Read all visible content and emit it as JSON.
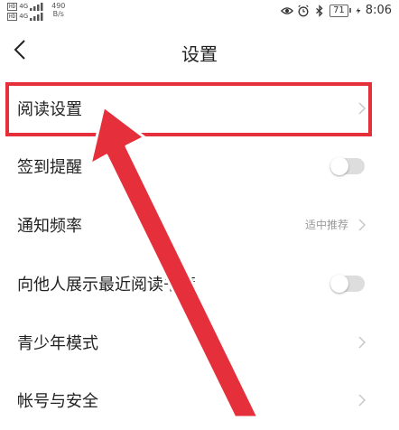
{
  "status_bar": {
    "sim1_label": "4G",
    "sim2_label": "4G",
    "net_speed_value": "490",
    "net_speed_unit": "B/s",
    "battery": "71",
    "time": "8:06"
  },
  "header": {
    "title": "设置"
  },
  "rows": [
    {
      "label": "阅读设置"
    },
    {
      "label": "签到提醒",
      "toggle": false
    },
    {
      "label": "通知频率",
      "value": "适中推荐"
    },
    {
      "label": "向他人展示最近阅读书籍",
      "toggle": false
    },
    {
      "label": "青少年模式"
    },
    {
      "label": "帐号与安全"
    }
  ],
  "colors": {
    "annotation_red": "#e5303b",
    "toggle_off": "#dddddd"
  }
}
